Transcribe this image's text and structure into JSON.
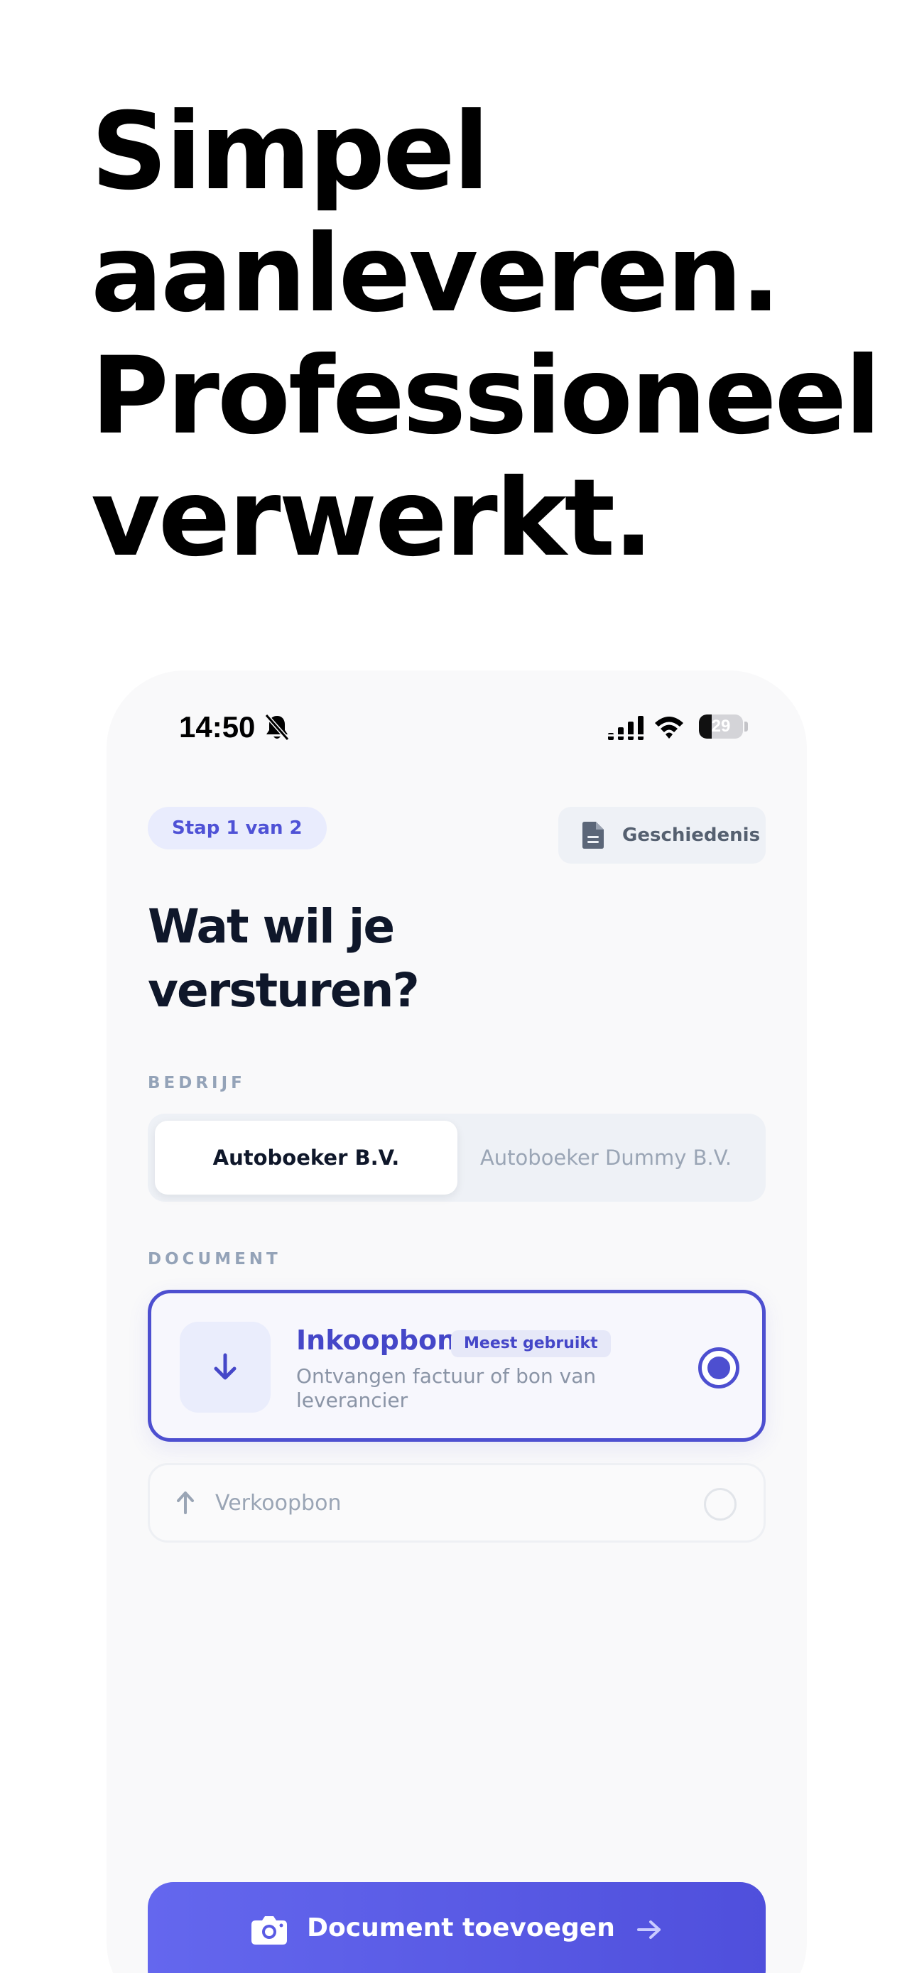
{
  "headline": {
    "lines": [
      "Simpel",
      "aanleveren.",
      "Professioneel",
      "verwerkt."
    ]
  },
  "status_bar": {
    "time": "14:50",
    "battery_level": 29,
    "battery_text": "29",
    "icons": [
      "bell-slash-icon",
      "cellular-signal-icon",
      "wifi-icon",
      "battery-icon"
    ]
  },
  "header": {
    "step_badge": "Stap 1 van 2",
    "history_label": "Geschiedenis",
    "history_icon": "document-icon"
  },
  "title": {
    "line1": "Wat wil je",
    "line2": "versturen?"
  },
  "company": {
    "label": "BEDRIJF",
    "options": [
      {
        "label": "Autoboeker B.V.",
        "selected": true
      },
      {
        "label": "Autoboeker Dummy B.V.",
        "selected": false
      }
    ]
  },
  "document": {
    "label": "DOCUMENT",
    "options": [
      {
        "title": "Inkoopbon",
        "badge": "Meest gebruikt",
        "description": "Ontvangen factuur of bon van leverancier",
        "icon": "arrow-down-icon",
        "selected": true
      },
      {
        "title": "Verkoopbon",
        "icon": "arrow-up-icon",
        "selected": false
      }
    ]
  },
  "cta": {
    "label": "Document toevoegen",
    "icon": "camera-icon",
    "trailing_icon": "arrow-right-icon"
  },
  "colors": {
    "accent": "#4d4fd0",
    "accent_light": "#e9ecfd",
    "cta_gradient_start": "#6467ee",
    "cta_gradient_end": "#4f4fdc",
    "text_dark": "#0f172a",
    "text_muted": "#94a3b8"
  }
}
